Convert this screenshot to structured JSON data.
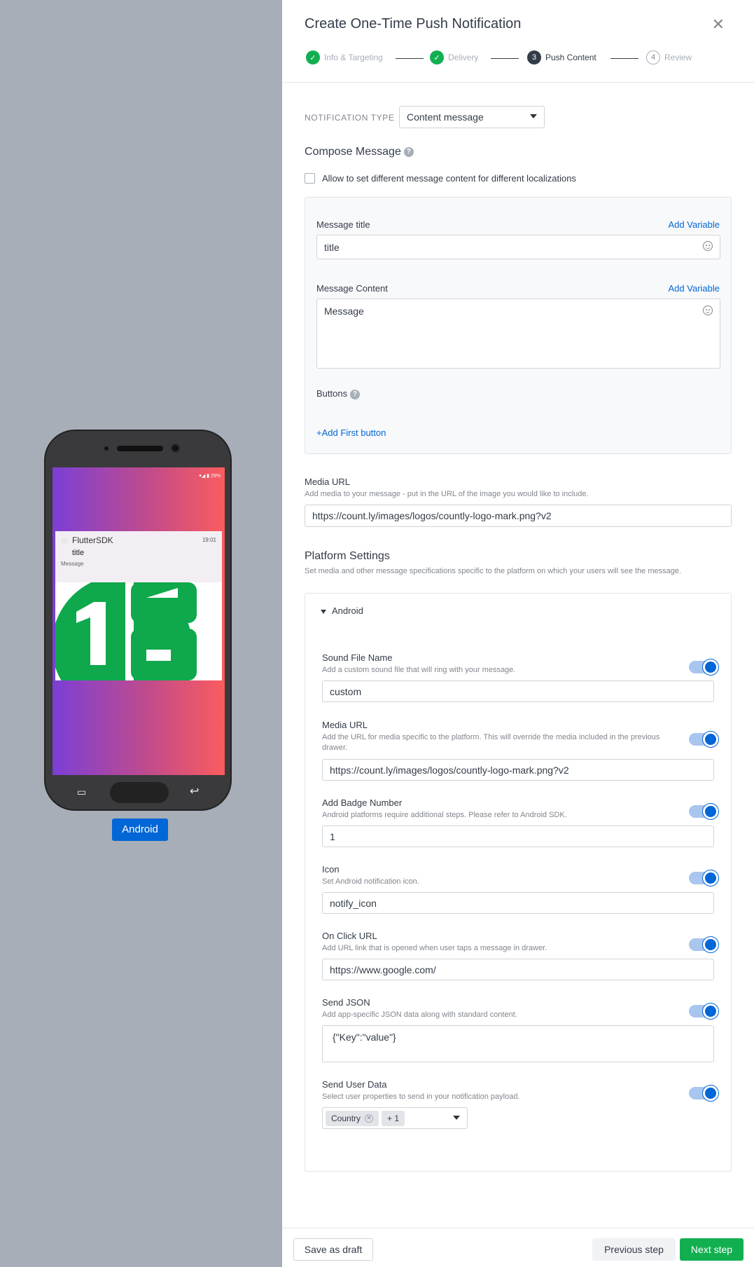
{
  "preview": {
    "status_text": "29%",
    "app_name": "FlutterSDK",
    "time": "19:01",
    "title": "title",
    "message": "Message",
    "platform_button": "Android"
  },
  "drawer": {
    "title": "Create One-Time Push Notification",
    "steps": [
      {
        "label": "Info & Targeting",
        "state": "done",
        "num": "1"
      },
      {
        "label": "Delivery",
        "state": "done",
        "num": "2"
      },
      {
        "label": "Push Content",
        "state": "active",
        "num": "3"
      },
      {
        "label": "Review",
        "state": "todo",
        "num": "4"
      }
    ],
    "notification_type_label": "NOTIFICATION TYPE",
    "notification_type_value": "Content message",
    "compose_heading": "Compose Message",
    "localization_checkbox": "Allow to set different message content for different localizations",
    "message_title_label": "Message title",
    "add_variable": "Add Variable",
    "message_title_value": "title",
    "message_content_label": "Message Content",
    "message_content_value": "Message",
    "buttons_label": "Buttons",
    "add_first_button": "+Add First button",
    "media_url_label": "Media URL",
    "media_url_desc": "Add media to your message - put in the URL of the image you would like to include.",
    "media_url_value": "https://count.ly/images/logos/countly-logo-mark.png?v2",
    "platform_heading": "Platform Settings",
    "platform_desc": "Set media and other message specifications specific to the platform on which your users will see the message.",
    "android_label": "Android",
    "android": {
      "sound": {
        "label": "Sound File Name",
        "desc": "Add a custom sound file that will ring with your message.",
        "value": "custom"
      },
      "media": {
        "label": "Media URL",
        "desc": "Add the URL for media specific to the platform. This will override the media included in the previous drawer.",
        "value": "https://count.ly/images/logos/countly-logo-mark.png?v2"
      },
      "badge": {
        "label": "Add Badge Number",
        "desc": "Android platforms require additional steps. Please refer to Android SDK.",
        "value": "1"
      },
      "icon": {
        "label": "Icon",
        "desc": "Set Android notification icon.",
        "value": "notify_icon"
      },
      "onclick": {
        "label": "On Click URL",
        "desc": "Add URL link that is opened when user taps a message in drawer.",
        "value": "https://www.google.com/"
      },
      "json": {
        "label": "Send JSON",
        "desc": "Add app-specific JSON data along with standard content.",
        "value": "{\"Key\":\"value\"}"
      },
      "userdata": {
        "label": "Send User Data",
        "desc": "Select user properties to send in your notification payload.",
        "tag": "Country",
        "more": "+ 1"
      }
    },
    "footer": {
      "save_draft": "Save as draft",
      "previous": "Previous step",
      "next": "Next step"
    }
  },
  "colors": {
    "primary": "#0166d6",
    "success": "#12af51",
    "text": "#333c48",
    "muted": "#81868d"
  }
}
